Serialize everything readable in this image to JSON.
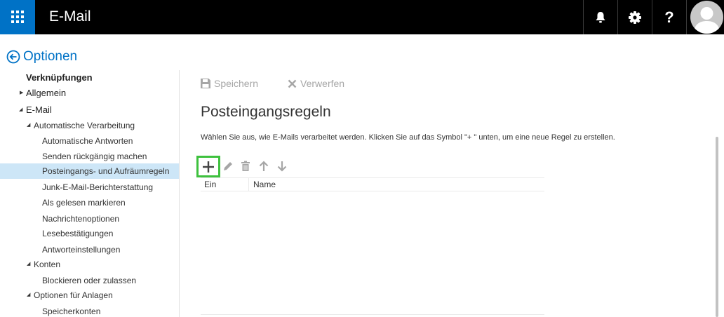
{
  "app": {
    "title": "E-Mail",
    "help_label": "?"
  },
  "options": {
    "title": "Optionen"
  },
  "sidebar": {
    "items": [
      {
        "label": "Verknüpfungen",
        "level": 0
      },
      {
        "label": "Allgemein",
        "level": 1,
        "expanded": false
      },
      {
        "label": "E-Mail",
        "level": 1,
        "expanded": true
      },
      {
        "label": "Automatische Verarbeitung",
        "level": 2,
        "expanded": true
      },
      {
        "label": "Automatische Antworten",
        "level": 3
      },
      {
        "label": "Senden rückgängig machen",
        "level": 3
      },
      {
        "label": "Posteingangs- und Aufräumregeln",
        "level": 3,
        "selected": true
      },
      {
        "label": "Junk-E-Mail-Berichterstattung",
        "level": 3
      },
      {
        "label": "Als gelesen markieren",
        "level": 3
      },
      {
        "label": "Nachrichtenoptionen",
        "level": 3
      },
      {
        "label": "Lesebestätigungen",
        "level": 3
      },
      {
        "label": "Antworteinstellungen",
        "level": 3
      },
      {
        "label": "Konten",
        "level": 2,
        "expanded": true
      },
      {
        "label": "Blockieren oder zulassen",
        "level": 3
      },
      {
        "label": "Optionen für Anlagen",
        "level": 2,
        "expanded": true
      },
      {
        "label": "Speicherkonten",
        "level": 3
      }
    ]
  },
  "toolbar": {
    "save_label": "Speichern",
    "discard_label": "Verwerfen"
  },
  "main": {
    "title": "Posteingangsregeln",
    "instruction": "Wählen Sie aus, wie E-Mails verarbeitet werden. Klicken Sie auf das Symbol \"+ \" unten, um eine neue Regel zu erstellen.",
    "table": {
      "columns": [
        "Ein",
        "Name"
      ],
      "rows": []
    }
  },
  "colors": {
    "topbar": "#000000",
    "waffle": "#0072c6",
    "accent": "#0072c6",
    "selected": "#cde6f7",
    "highlight": "#3ec13e",
    "disabled": "#a6a6a6"
  },
  "icons": {
    "waffle": "app-launcher-icon",
    "bell": "bell-icon",
    "gear": "gear-icon",
    "help": "help-icon",
    "back": "back-arrow-icon",
    "save": "save-icon",
    "discard": "close-icon",
    "add": "plus-icon",
    "edit": "pencil-icon",
    "delete": "trash-icon",
    "up": "arrow-up-icon",
    "down": "arrow-down-icon"
  }
}
